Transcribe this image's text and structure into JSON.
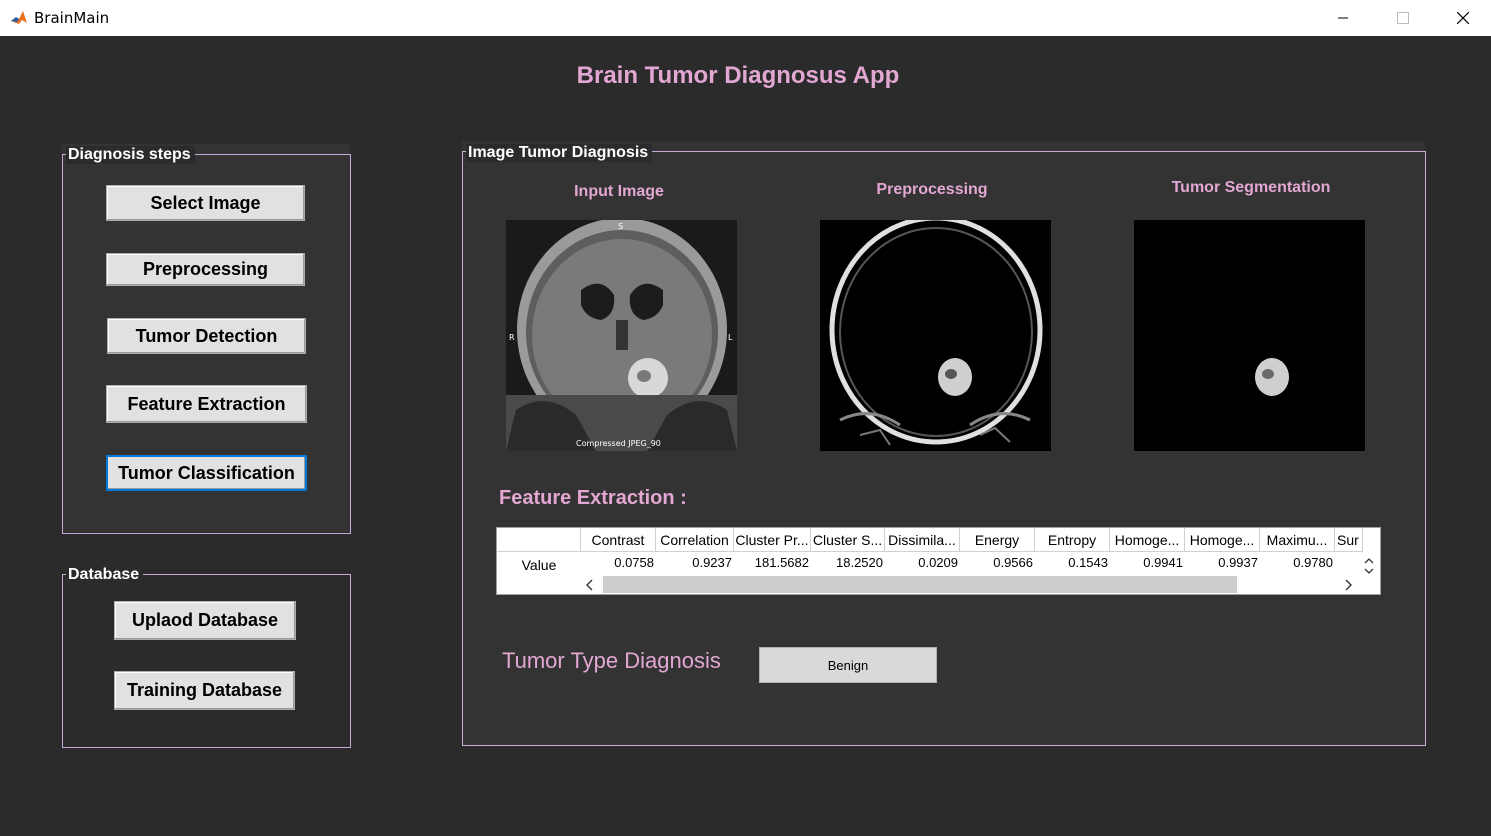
{
  "window": {
    "title": "BrainMain"
  },
  "app_title": "Brain Tumor Diagnosus App",
  "diagnosis_panel": {
    "title": "Diagnosis steps",
    "buttons": [
      "Select Image",
      "Preprocessing",
      "Tumor Detection",
      "Feature Extraction",
      "Tumor Classification"
    ]
  },
  "database_panel": {
    "title": "Database",
    "buttons": [
      "Uplaod Database",
      "Training Database"
    ]
  },
  "image_panel": {
    "title": "Image Tumor Diagnosis",
    "images": [
      "Input Image",
      "Preprocessing",
      "Tumor Segmentation"
    ],
    "feature_label": "Feature Extraction :",
    "table": {
      "columns": [
        "Contrast",
        "Correlation",
        "Cluster Pr...",
        "Cluster S...",
        "Dissimila...",
        "Energy",
        "Entropy",
        "Homoge...",
        "Homoge...",
        "Maximu...",
        "Sur"
      ],
      "row_label": "Value",
      "values": [
        "0.0758",
        "0.9237",
        "181.5682",
        "18.2520",
        "0.0209",
        "0.9566",
        "0.1543",
        "0.9941",
        "0.9937",
        "0.9780",
        ""
      ]
    },
    "diagnosis_label": "Tumor Type Diagnosis",
    "diagnosis_result": "Benign"
  },
  "colors": {
    "accent": "#e3a7d3",
    "background": "#2b2b2b",
    "panel_border": "#c8a8d8"
  }
}
